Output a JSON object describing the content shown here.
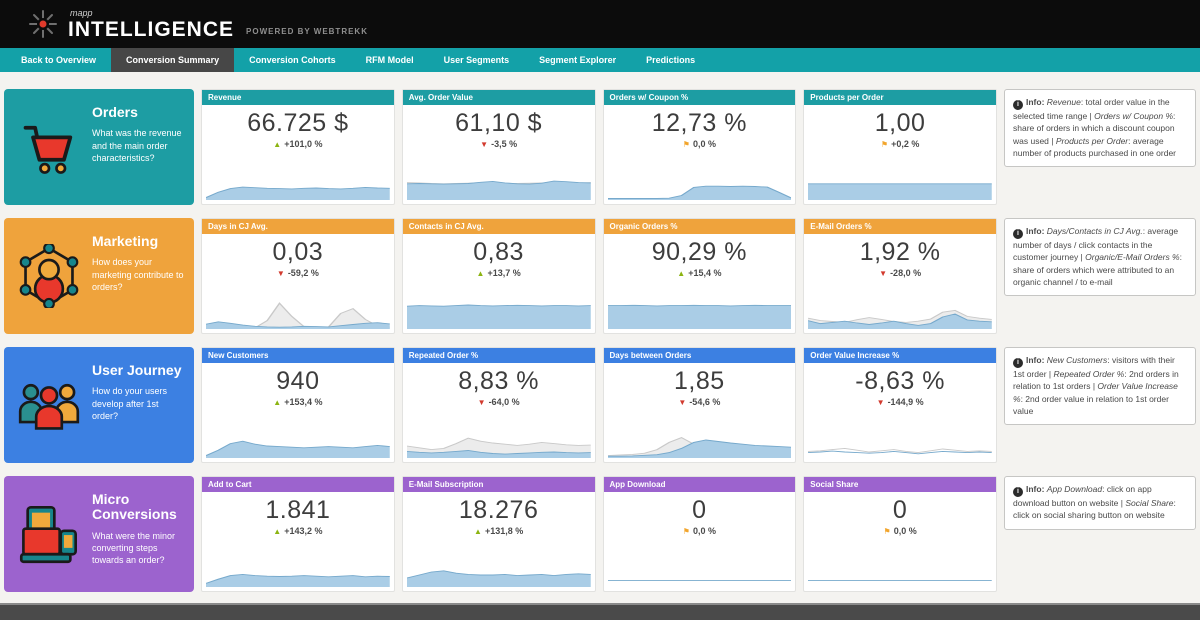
{
  "header": {
    "brand_small": "mapp",
    "brand_main": "INTELLIGENCE",
    "brand_sub": "POWERED BY WEBTREKK"
  },
  "nav": {
    "tabs": [
      {
        "label": "Back to Overview"
      },
      {
        "label": "Conversion Summary",
        "active": true
      },
      {
        "label": "Conversion Cohorts"
      },
      {
        "label": "RFM Model"
      },
      {
        "label": "User Segments"
      },
      {
        "label": "Segment Explorer"
      },
      {
        "label": "Predictions"
      }
    ]
  },
  "icons": {
    "info_glyph": "i"
  },
  "colors": {
    "teal": "#1d9da3",
    "orange": "#efa33c",
    "blue": "#3c80e2",
    "purple": "#9c63ce",
    "spark_blue_fill": "#aacde6",
    "spark_blue_line": "#76a9cc",
    "spark_gray_fill": "#ececec",
    "spark_gray_line": "#c9c9c9",
    "trend_up": "#8cb411",
    "trend_down": "#d23a2e",
    "trend_flat": "#f2a52c"
  },
  "rows": [
    {
      "title": "Orders",
      "description": "What was the revenue and the main order characteristics?",
      "color": "#1d9da3",
      "icon": "shopping-cart-icon",
      "kpis": [
        {
          "label": "Revenue",
          "value": "66.725 $",
          "trend": "up",
          "trend_glyph": "▲",
          "delta": "+101,0 %",
          "spark": {
            "blue": [
              8,
              26,
              38,
              43,
              41,
              39,
              38,
              37,
              39,
              40,
              38,
              37,
              39,
              42,
              40,
              39
            ]
          }
        },
        {
          "label": "Avg. Order Value",
          "value": "61,10 $",
          "trend": "down",
          "trend_glyph": "▼",
          "delta": "-3,5 %",
          "spark": {
            "gray": [
              58,
              57,
              55,
              54,
              55,
              56,
              57,
              55,
              54,
              55,
              56,
              57,
              56,
              55,
              56,
              58
            ],
            "blue": [
              54,
              55,
              54,
              53,
              54,
              55,
              59,
              62,
              57,
              54,
              53,
              56,
              63,
              61,
              58,
              57
            ]
          }
        },
        {
          "label": "Orders w/ Coupon %",
          "value": "12,73 %",
          "trend": "flat",
          "trend_glyph": "⚑",
          "delta": "0,0 %",
          "spark": {
            "blue": [
              5,
              5,
              5,
              5,
              5,
              6,
              15,
              42,
              46,
              46,
              45,
              46,
              45,
              43,
              25,
              6
            ]
          }
        },
        {
          "label": "Products per Order",
          "value": "1,00",
          "trend": "flat",
          "trend_glyph": "⚑",
          "delta": "+0,2 %",
          "spark": {
            "blue": [
              54,
              54,
              54,
              54,
              54,
              54,
              54,
              54,
              54,
              54,
              54,
              54,
              54,
              54,
              54,
              54
            ]
          }
        }
      ],
      "info": {
        "prefix": "Info:",
        "segments": [
          {
            "text": "Revenue",
            "italic": true
          },
          {
            "text": ": total order value in the selected time range | ",
            "italic": false
          },
          {
            "text": "Orders w/ Coupon %",
            "italic": true
          },
          {
            "text": ": share of orders in which a discount coupon was used | ",
            "italic": false
          },
          {
            "text": "Products per Order",
            "italic": true
          },
          {
            "text": ": average number of products purchased in one order",
            "italic": false
          }
        ]
      }
    },
    {
      "title": "Marketing",
      "description": "How does your marketing contribute to orders?",
      "color": "#efa33c",
      "icon": "marketing-network-icon",
      "kpis": [
        {
          "label": "Days in CJ Avg.",
          "value": "0,03",
          "trend": "down",
          "trend_glyph": "▼",
          "delta": "-59,2 %",
          "spark": {
            "gray": [
              6,
              14,
              9,
              5,
              4,
              28,
              86,
              42,
              8,
              5,
              7,
              52,
              68,
              32,
              10,
              6
            ],
            "blue": [
              16,
              24,
              19,
              13,
              9,
              7,
              6,
              7,
              9,
              8,
              7,
              11,
              15,
              19,
              21,
              17
            ]
          }
        },
        {
          "label": "Contacts in CJ Avg.",
          "value": "0,83",
          "trend": "up",
          "trend_glyph": "▲",
          "delta": "+13,7 %",
          "spark": {
            "blue": [
              76,
              78,
              77,
              76,
              78,
              80,
              78,
              77,
              78,
              79,
              78,
              77,
              78,
              78,
              77,
              78
            ]
          }
        },
        {
          "label": "Organic Orders %",
          "value": "90,29 %",
          "trend": "up",
          "trend_glyph": "▲",
          "delta": "+15,4 %",
          "spark": {
            "blue": [
              78,
              78,
              79,
              78,
              77,
              78,
              78,
              79,
              78,
              78,
              77,
              78,
              79,
              78,
              78,
              78
            ]
          }
        },
        {
          "label": "E-Mail Orders %",
          "value": "1,92 %",
          "trend": "down",
          "trend_glyph": "▼",
          "delta": "-28,0 %",
          "spark": {
            "gray": [
              36,
              28,
              25,
              22,
              31,
              38,
              32,
              25,
              22,
              26,
              33,
              56,
              62,
              42,
              36,
              32
            ],
            "blue": [
              28,
              18,
              22,
              26,
              20,
              15,
              20,
              26,
              18,
              12,
              18,
              40,
              50,
              30,
              26,
              24
            ]
          }
        }
      ],
      "info": {
        "prefix": "Info:",
        "segments": [
          {
            "text": "Days/Contacts in CJ  Avg.",
            "italic": true
          },
          {
            "text": ": average number of days / click contacts in the customer journey | ",
            "italic": false
          },
          {
            "text": "Organic/E-Mail Orders %",
            "italic": true
          },
          {
            "text": ": share of orders which were attributed to an organic channel / to e-mail",
            "italic": false
          }
        ]
      }
    },
    {
      "title": "User Journey",
      "description": "How do your users develop after 1st order?",
      "color": "#3c80e2",
      "icon": "user-group-icon",
      "kpis": [
        {
          "label": "New Customers",
          "value": "940",
          "trend": "up",
          "trend_glyph": "▲",
          "delta": "+153,4 %",
          "spark": {
            "blue": [
              8,
              26,
              48,
              56,
              46,
              40,
              38,
              36,
              34,
              36,
              38,
              36,
              34,
              38,
              42,
              38
            ]
          }
        },
        {
          "label": "Repeated Order %",
          "value": "8,83 %",
          "trend": "down",
          "trend_glyph": "▼",
          "delta": "-64,0 %",
          "spark": {
            "gray": [
              40,
              34,
              28,
              32,
              48,
              66,
              56,
              50,
              46,
              42,
              46,
              52,
              48,
              44,
              42,
              43
            ],
            "blue": [
              22,
              19,
              17,
              19,
              22,
              25,
              19,
              15,
              13,
              15,
              17,
              19,
              20,
              18,
              17,
              18
            ]
          }
        },
        {
          "label": "Days between Orders",
          "value": "1,85",
          "trend": "down",
          "trend_glyph": "▼",
          "delta": "-54,6 %",
          "spark": {
            "gray": [
              8,
              10,
              12,
              16,
              28,
              52,
              68,
              46,
              28,
              22,
              18,
              14,
              12,
              10,
              9,
              8
            ],
            "blue": [
              6,
              6,
              7,
              9,
              11,
              18,
              32,
              52,
              60,
              55,
              50,
              46,
              42,
              40,
              38,
              36
            ]
          }
        },
        {
          "label": "Order Value Increase %",
          "value": "-8,63 %",
          "trend": "down",
          "trend_glyph": "▼",
          "delta": "-144,9 %",
          "spark": {
            "noFill": true,
            "gray": [
              22,
              24,
              28,
              32,
              26,
              20,
              24,
              28,
              22,
              18,
              24,
              30,
              26,
              22,
              24,
              22
            ],
            "blue": [
              18,
              20,
              23,
              20,
              18,
              16,
              18,
              22,
              18,
              14,
              18,
              22,
              20,
              18,
              20,
              18
            ]
          }
        }
      ],
      "info": {
        "prefix": "Info:",
        "segments": [
          {
            "text": "New Customers",
            "italic": true
          },
          {
            "text": ": visitors with their 1st order | ",
            "italic": false
          },
          {
            "text": "Repeated Order %",
            "italic": true
          },
          {
            "text": ": 2nd orders in relation to 1st orders | ",
            "italic": false
          },
          {
            "text": "Order Value Increase %",
            "italic": true
          },
          {
            "text": ": 2nd order value in relation to 1st order value",
            "italic": false
          }
        ]
      }
    },
    {
      "title": "Micro Conversions",
      "description": "What were the minor converting steps towards an order?",
      "color": "#9c63ce",
      "icon": "devices-icon",
      "kpis": [
        {
          "label": "Add to Cart",
          "value": "1.841",
          "trend": "up",
          "trend_glyph": "▲",
          "delta": "+143,2 %",
          "spark": {
            "blue": [
              12,
              26,
              38,
              42,
              38,
              36,
              35,
              36,
              38,
              36,
              34,
              36,
              38,
              34,
              36,
              35
            ]
          }
        },
        {
          "label": "E-Mail Subscription",
          "value": "18.276",
          "trend": "up",
          "trend_glyph": "▲",
          "delta": "+131,8 %",
          "spark": {
            "blue": [
              30,
              40,
              50,
              54,
              46,
              42,
              40,
              40,
              42,
              38,
              40,
              42,
              38,
              42,
              44,
              42
            ]
          }
        },
        {
          "label": "App Download",
          "value": "0",
          "trend": "flat",
          "trend_glyph": "⚑",
          "delta": "0,0 %",
          "spark": {
            "noFill": true,
            "blue": [
              22,
              22,
              22,
              22,
              22,
              22,
              22,
              22,
              22,
              22,
              22,
              22,
              22,
              22,
              22,
              22
            ]
          }
        },
        {
          "label": "Social Share",
          "value": "0",
          "trend": "flat",
          "trend_glyph": "⚑",
          "delta": "0,0 %",
          "spark": {
            "noFill": true,
            "blue": [
              22,
              22,
              22,
              22,
              22,
              22,
              22,
              22,
              22,
              22,
              22,
              22,
              22,
              22,
              22,
              22
            ]
          }
        }
      ],
      "info": {
        "prefix": "Info:",
        "segments": [
          {
            "text": "App Download",
            "italic": true
          },
          {
            "text": ": click on app download button on website | ",
            "italic": false
          },
          {
            "text": "Social Share",
            "italic": true
          },
          {
            "text": ": click on social sharing button on website",
            "italic": false
          }
        ]
      }
    }
  ]
}
